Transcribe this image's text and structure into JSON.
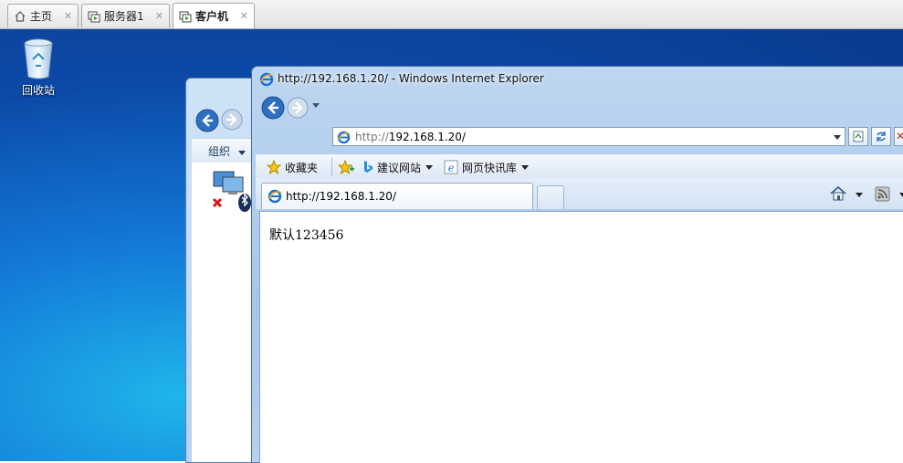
{
  "vmware_tabs": [
    {
      "label": "主页",
      "icon": "home-icon",
      "active": false
    },
    {
      "label": "服务器1",
      "icon": "vm-icon",
      "active": false
    },
    {
      "label": "客户机",
      "icon": "vm-icon",
      "active": true
    }
  ],
  "desktop": {
    "icons": [
      {
        "label": "回收站",
        "icon": "recycle-bin-icon"
      }
    ]
  },
  "explorer": {
    "organize_label": "组织"
  },
  "ie": {
    "title": "http://192.168.1.20/ - Windows Internet Explorer",
    "address": {
      "scheme": "http://",
      "host": "192.168.1.20/"
    },
    "favorites_bar": {
      "favorites_label": "收藏夹",
      "items": [
        {
          "label": "建议网站",
          "icon": "bing-icon",
          "dropdown": true
        },
        {
          "label": "网页快讯库",
          "icon": "ie-icon",
          "dropdown": true
        }
      ]
    },
    "tab": {
      "label": "http://192.168.1.20/"
    },
    "page": {
      "text": "默认123456"
    }
  },
  "colors": {
    "desktop_blue": "#0c4aa8",
    "ie_frame": "#a7c6e8",
    "stop_red": "#d21111"
  }
}
